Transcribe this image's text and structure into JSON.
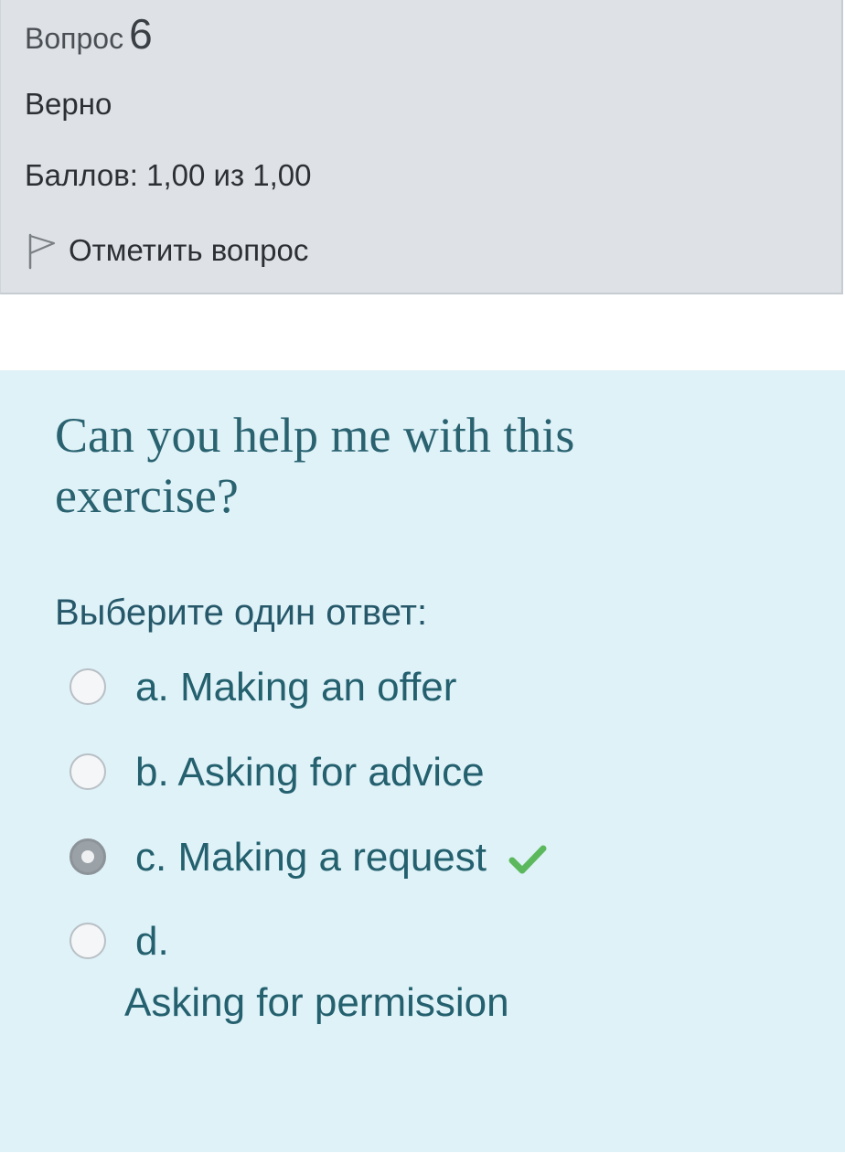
{
  "question_info": {
    "label": "Вопрос",
    "number": "6",
    "state": "Верно",
    "grade": "Баллов: 1,00 из 1,00",
    "flag_label": "Отметить вопрос"
  },
  "question": {
    "text": "Can you help me with this exercise?",
    "prompt": "Выберите один ответ:",
    "answers": [
      {
        "letter": "a.",
        "text": "Making an offer",
        "selected": false
      },
      {
        "letter": "b.",
        "text": "Asking for advice",
        "selected": false
      },
      {
        "letter": "c.",
        "text": "Making a request",
        "selected": true,
        "correct": true
      },
      {
        "letter": "d.",
        "text": "Asking for permission",
        "selected": false
      }
    ]
  },
  "colors": {
    "info_bg": "#dee2e6",
    "content_bg": "#def2f8",
    "text_accent": "#24606e",
    "correct_check": "#5cb85c"
  },
  "icons": {
    "flag": "flag-icon",
    "correct": "check-icon"
  }
}
